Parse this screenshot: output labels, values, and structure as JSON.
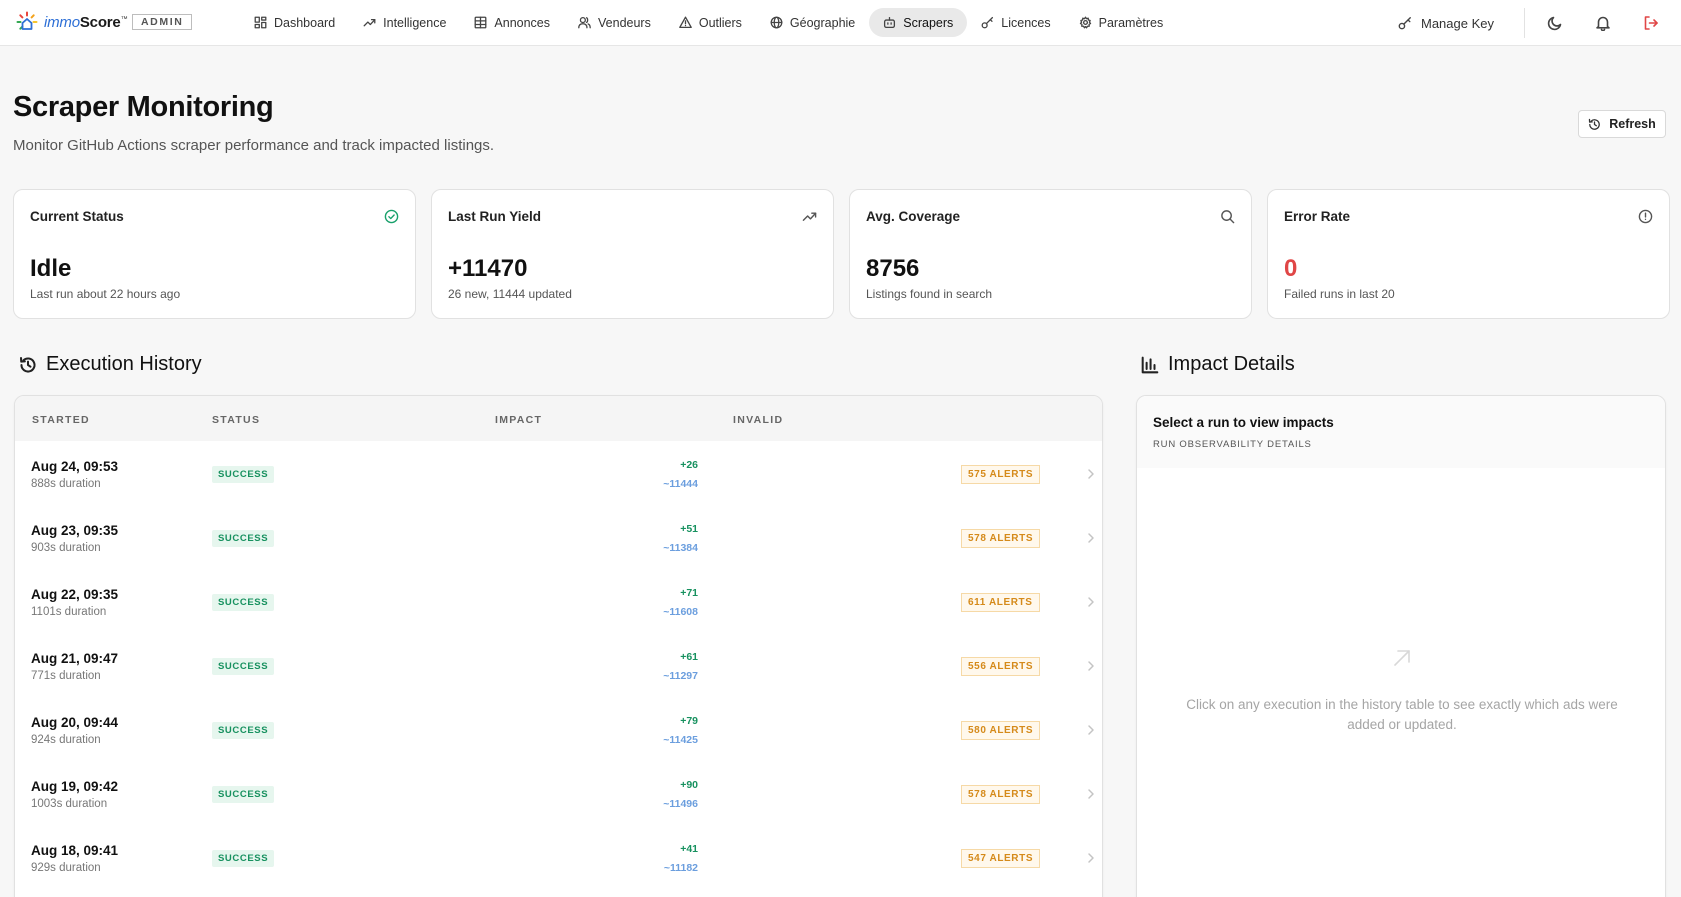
{
  "brand": {
    "name_part1": "immo",
    "name_part2": "Score",
    "trademark": "™",
    "role_badge": "ADMIN"
  },
  "nav": {
    "items": [
      {
        "label": "Dashboard",
        "icon": "grid-icon",
        "active": false
      },
      {
        "label": "Intelligence",
        "icon": "trending-up-icon",
        "active": false
      },
      {
        "label": "Annonces",
        "icon": "table-icon",
        "active": false
      },
      {
        "label": "Vendeurs",
        "icon": "users-icon",
        "active": false
      },
      {
        "label": "Outliers",
        "icon": "warning-triangle-icon",
        "active": false
      },
      {
        "label": "Géographie",
        "icon": "globe-icon",
        "active": false
      },
      {
        "label": "Scrapers",
        "icon": "bot-icon",
        "active": true
      },
      {
        "label": "Licences",
        "icon": "key-icon",
        "active": false
      },
      {
        "label": "Paramètres",
        "icon": "gear-icon",
        "active": false
      }
    ],
    "manage_key": "Manage Key"
  },
  "header": {
    "title": "Scraper Monitoring",
    "subtitle": "Monitor GitHub Actions scraper performance and track impacted listings.",
    "refresh_label": "Refresh"
  },
  "stats": [
    {
      "title": "Current Status",
      "value": "Idle",
      "sub": "Last run about 22 hours ago",
      "icon": "check-circle-icon"
    },
    {
      "title": "Last Run Yield",
      "value": "+11470",
      "sub": "26 new, 11444 updated",
      "icon": "trending-up-icon"
    },
    {
      "title": "Avg. Coverage",
      "value": "8756",
      "sub": "Listings found in search",
      "icon": "search-icon"
    },
    {
      "title": "Error Rate",
      "value": "0",
      "sub": "Failed runs in last 20",
      "icon": "info-circle-icon"
    }
  ],
  "history": {
    "heading": "Execution History",
    "columns": [
      "STARTED",
      "STATUS",
      "IMPACT",
      "INVALID"
    ],
    "rows": [
      {
        "started": "Aug 24, 09:53",
        "duration": "888s duration",
        "status": "SUCCESS",
        "new": "+26",
        "updated": "~11444",
        "alerts": "575 ALERTS"
      },
      {
        "started": "Aug 23, 09:35",
        "duration": "903s duration",
        "status": "SUCCESS",
        "new": "+51",
        "updated": "~11384",
        "alerts": "578 ALERTS"
      },
      {
        "started": "Aug 22, 09:35",
        "duration": "1101s duration",
        "status": "SUCCESS",
        "new": "+71",
        "updated": "~11608",
        "alerts": "611 ALERTS"
      },
      {
        "started": "Aug 21, 09:47",
        "duration": "771s duration",
        "status": "SUCCESS",
        "new": "+61",
        "updated": "~11297",
        "alerts": "556 ALERTS"
      },
      {
        "started": "Aug 20, 09:44",
        "duration": "924s duration",
        "status": "SUCCESS",
        "new": "+79",
        "updated": "~11425",
        "alerts": "580 ALERTS"
      },
      {
        "started": "Aug 19, 09:42",
        "duration": "1003s duration",
        "status": "SUCCESS",
        "new": "+90",
        "updated": "~11496",
        "alerts": "578 ALERTS"
      },
      {
        "started": "Aug 18, 09:41",
        "duration": "929s duration",
        "status": "SUCCESS",
        "new": "+41",
        "updated": "~11182",
        "alerts": "547 ALERTS"
      }
    ]
  },
  "impact": {
    "heading": "Impact Details",
    "panel_title": "Select a run to view impacts",
    "panel_subtitle": "RUN OBSERVABILITY DETAILS",
    "empty_text": "Click on any execution in the history table to see exactly which ads were added or updated."
  },
  "colors": {
    "success": "#17915f",
    "updated": "#6b9ede",
    "alert": "#d58a1a",
    "error": "#e04646"
  }
}
